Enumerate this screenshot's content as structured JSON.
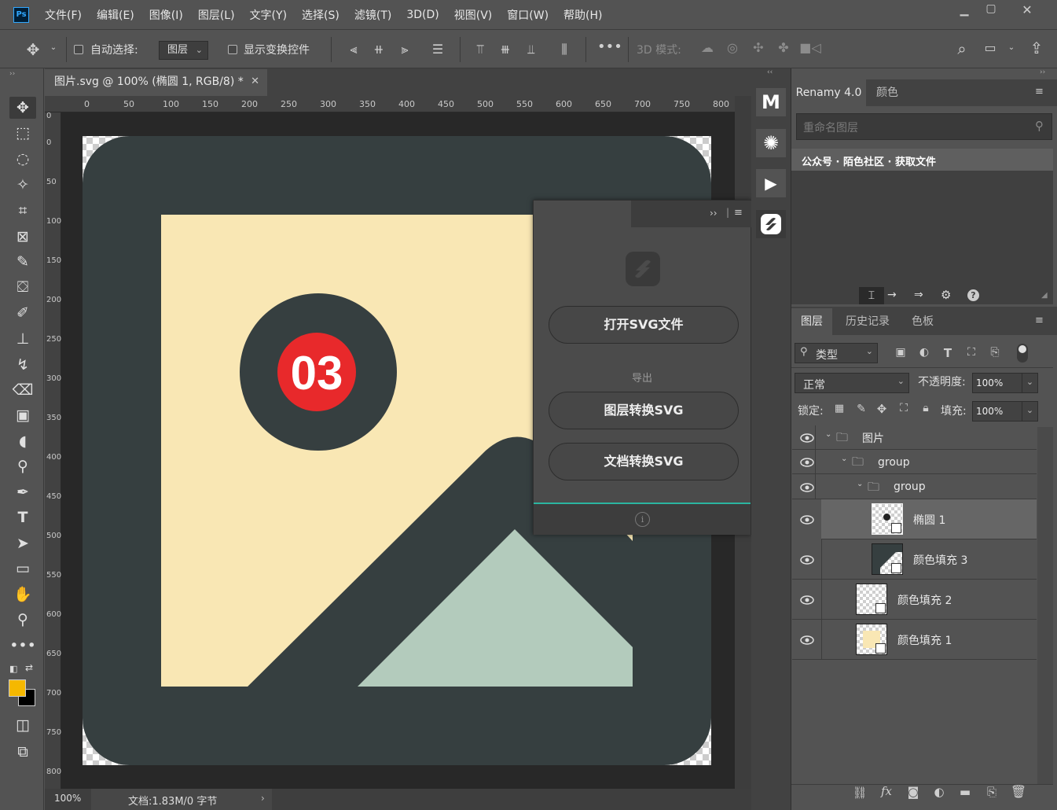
{
  "app": {
    "logo": "Ps"
  },
  "menu": [
    "文件(F)",
    "编辑(E)",
    "图像(I)",
    "图层(L)",
    "文字(Y)",
    "选择(S)",
    "滤镜(T)",
    "3D(D)",
    "视图(V)",
    "窗口(W)",
    "帮助(H)"
  ],
  "options": {
    "auto_select_label": "自动选择:",
    "auto_select_value": "图层",
    "show_transform_label": "显示变换控件",
    "mode3d_label": "3D 模式:"
  },
  "document": {
    "tab_title": "图片.svg @ 100% (椭圆 1, RGB/8) *",
    "zoom": "100%",
    "doc_info": "文档:1.83M/0 字节",
    "ruler_top": [
      "0",
      "50",
      "100",
      "150",
      "200",
      "250",
      "300",
      "350",
      "400",
      "450",
      "500",
      "550",
      "600",
      "650",
      "700",
      "750",
      "800"
    ],
    "ruler_left": [
      "0",
      "0",
      "50",
      "100",
      "150",
      "200",
      "250",
      "300",
      "350",
      "400",
      "450",
      "500",
      "550",
      "600",
      "650",
      "700",
      "750",
      "800"
    ],
    "badge_text": "03"
  },
  "svg_panel": {
    "open_button": "打开SVG文件",
    "export_label": "导出",
    "layer_button": "图层转换SVG",
    "doc_button": "文档转换SVG",
    "collapse_icon": "››"
  },
  "renamy_panel": {
    "tab1": "Renamy 4.0",
    "tab2": "颜色",
    "search_placeholder": "重命名图层",
    "info_text": "公众号 · 陌色社区 · 获取文件"
  },
  "layers_panel": {
    "tabs": [
      "图层",
      "历史记录",
      "色板"
    ],
    "filter_label": "类型",
    "blend_mode": "正常",
    "opacity_label": "不透明度:",
    "opacity_value": "100%",
    "lock_label": "锁定:",
    "fill_label": "填充:",
    "fill_value": "100%",
    "layers": [
      {
        "name": "图片",
        "type": "group"
      },
      {
        "name": "group",
        "type": "group"
      },
      {
        "name": "group",
        "type": "group"
      },
      {
        "name": "椭圆 1",
        "type": "shape",
        "selected": true
      },
      {
        "name": "颜色填充 3",
        "type": "shape"
      },
      {
        "name": "颜色填充 2",
        "type": "shape"
      },
      {
        "name": "颜色填充 1",
        "type": "shape"
      }
    ],
    "footer_fx": "fx"
  },
  "colors": {
    "foreground": "#f5b800",
    "background": "#000000",
    "artwork_frame": "#363f40",
    "artwork_sky": "#f9e7b4",
    "artwork_mountain": "#b3cbbc",
    "badge_red": "#e8292b",
    "accent_teal": "#2bb5a0"
  }
}
